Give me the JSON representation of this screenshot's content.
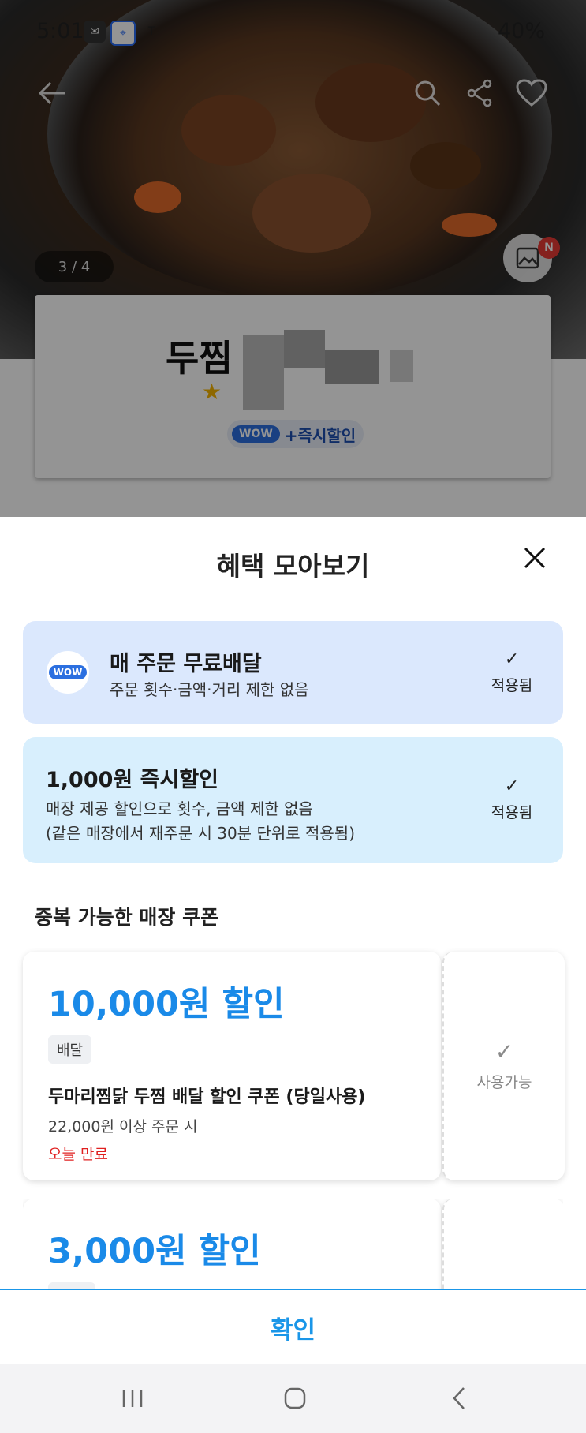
{
  "status_bar": {
    "time": "5:01",
    "right_text": "40%"
  },
  "hero": {
    "pager": "3 / 4",
    "gallery_badge": "N"
  },
  "store": {
    "name": "두찜",
    "tag_wow": "WOW",
    "tag_text": "+즉시할인"
  },
  "sheet": {
    "title": "혜택 모아보기",
    "benefits": [
      {
        "badge": "WOW",
        "title": "매 주문 무료배달",
        "desc": "주문 횟수·금액·거리 제한 없음",
        "status": "적용됨"
      },
      {
        "title": "1,000원 즉시할인",
        "desc1": "매장 제공 할인으로 횟수, 금액 제한 없음",
        "desc2": "(같은 매장에서 재주문 시 30분 단위로 적용됨)",
        "status": "적용됨"
      }
    ],
    "coupon_section_title": "중복 가능한 매장 쿠폰",
    "coupons": [
      {
        "amount": "10,000원 할인",
        "chip": "배달",
        "name": "두마리찜닭 두찜 배달 할인 쿠폰 (당일사용)",
        "condition": "22,000원 이상 주문 시",
        "expiry": "오늘 만료",
        "status": "사용가능"
      },
      {
        "amount": "3,000원 할인"
      }
    ],
    "confirm_label": "확인"
  },
  "colors": {
    "accent": "#1a96e8",
    "coupon_amount": "#1a8ae8",
    "wow_bg": "#dbe8fd",
    "instant_bg": "#d8effd",
    "expiry": "#e02020"
  }
}
